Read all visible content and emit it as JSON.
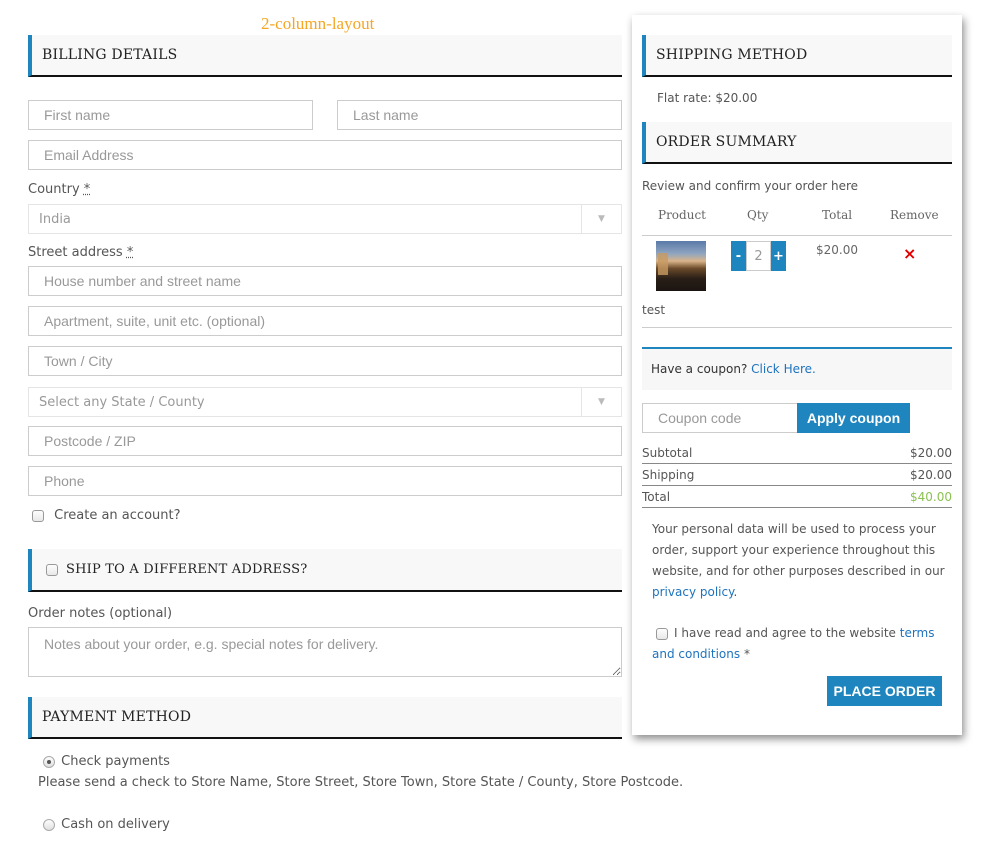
{
  "layout_label": "2-column-layout",
  "billing": {
    "title": "BILLING DETAILS",
    "first_name_placeholder": "First name",
    "last_name_placeholder": "Last name",
    "email_placeholder": "Email Address",
    "country_label": "Country",
    "country_value": "India",
    "required_mark": "*",
    "street_label": "Street address",
    "street1_placeholder": "House number and street name",
    "street2_placeholder": "Apartment, suite, unit etc. (optional)",
    "city_placeholder": "Town / City",
    "state_value": "Select any State / County",
    "postcode_placeholder": "Postcode / ZIP",
    "phone_placeholder": "Phone",
    "create_account_label": "Create an account?"
  },
  "ship_different": {
    "title": "SHIP TO A DIFFERENT ADDRESS?"
  },
  "order_notes": {
    "label": "Order notes (optional)",
    "placeholder": "Notes about your order, e.g. special notes for delivery."
  },
  "payment": {
    "title": "PAYMENT METHOD",
    "options": [
      {
        "label": "Check payments",
        "selected": true,
        "description": "Please send a check to Store Name, Store Street, Store Town, Store State / County, Store Postcode."
      },
      {
        "label": "Cash on delivery",
        "selected": false
      }
    ]
  },
  "shipping_method": {
    "title": "SHIPPING METHOD",
    "value": "Flat rate: $20.00"
  },
  "order_summary": {
    "title": "ORDER SUMMARY",
    "intro": "Review and confirm your order here",
    "columns": [
      "Product",
      "Qty",
      "Total",
      "Remove"
    ],
    "items": [
      {
        "name": "test",
        "qty": "2",
        "total": "$20.00",
        "minus": "-",
        "plus": "+",
        "remove_icon": "×"
      }
    ]
  },
  "coupon": {
    "prompt": "Have a coupon?",
    "link": "Click Here.",
    "placeholder": "Coupon code",
    "apply_label": "Apply coupon"
  },
  "totals": [
    {
      "label": "Subtotal",
      "value": "$20.00"
    },
    {
      "label": "Shipping",
      "value": "$20.00"
    },
    {
      "label": "Total",
      "value": "$40.00"
    }
  ],
  "privacy": {
    "text": "Your personal data will be used to process your order, support your experience throughout this website, and for other purposes described in our",
    "link": "privacy policy",
    "end": "."
  },
  "terms": {
    "text": "I have read and agree to the website",
    "link": "terms and conditions",
    "required": "*"
  },
  "place_order_label": "PLACE ORDER",
  "colors": {
    "accent": "#1e85be",
    "total_green": "#8cc152",
    "remove_red": "#e00000",
    "label_orange": "#f5a623"
  }
}
